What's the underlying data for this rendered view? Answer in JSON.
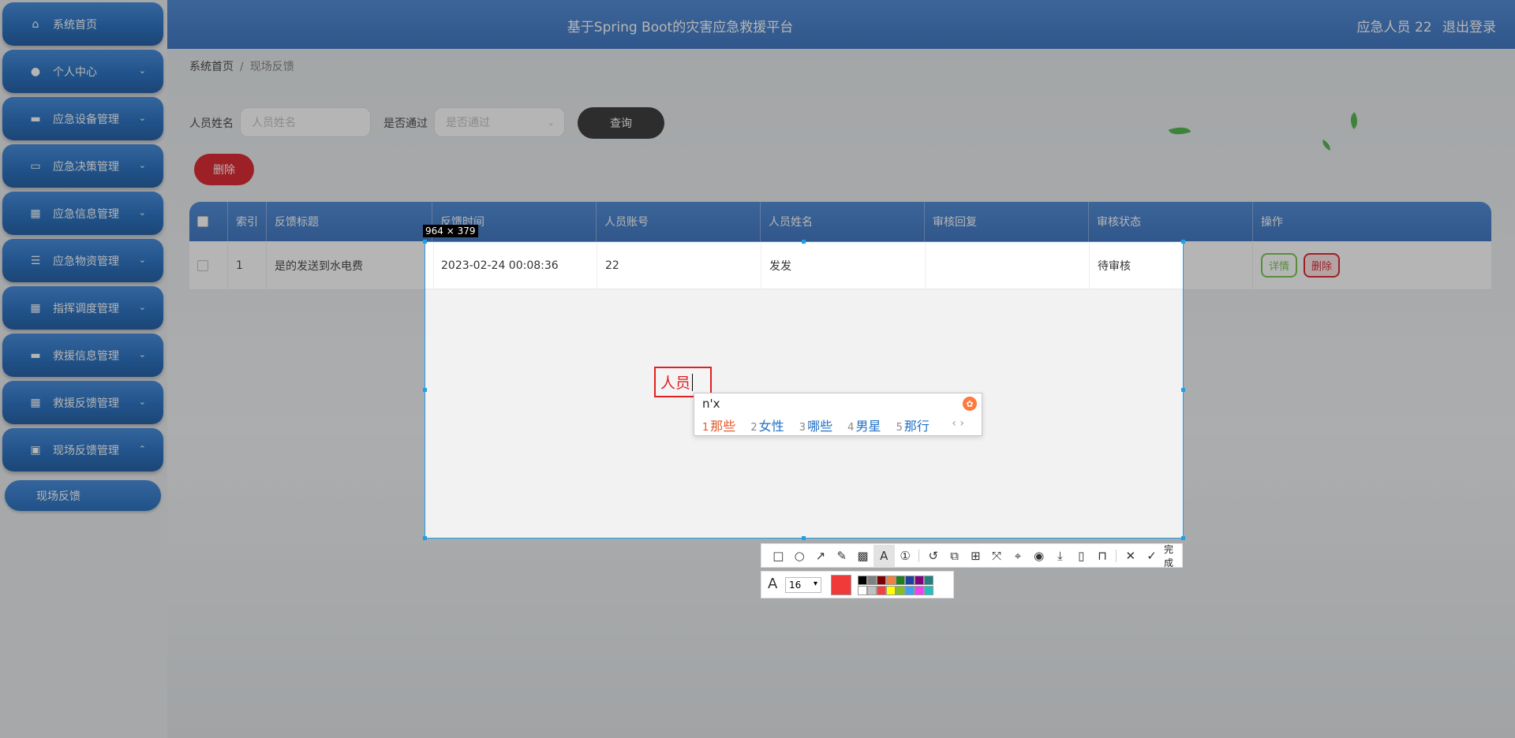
{
  "sidebar": {
    "items": [
      {
        "label": "系统首页",
        "icon": "home-icon",
        "chevron": ""
      },
      {
        "label": "个人中心",
        "icon": "user-icon",
        "chevron": "⌄"
      },
      {
        "label": "应急设备管理",
        "icon": "device-icon",
        "chevron": "⌄"
      },
      {
        "label": "应急决策管理",
        "icon": "monitor-icon",
        "chevron": "⌄"
      },
      {
        "label": "应急信息管理",
        "icon": "grid-icon",
        "chevron": "⌄"
      },
      {
        "label": "应急物资管理",
        "icon": "sliders-icon",
        "chevron": "⌄"
      },
      {
        "label": "指挥调度管理",
        "icon": "grid-icon",
        "chevron": "⌄"
      },
      {
        "label": "救援信息管理",
        "icon": "device-icon",
        "chevron": "⌄"
      },
      {
        "label": "救援反馈管理",
        "icon": "grid-icon",
        "chevron": "⌄"
      },
      {
        "label": "现场反馈管理",
        "icon": "briefcase-icon",
        "chevron": "⌃"
      }
    ],
    "submenu_label": "现场反馈"
  },
  "header": {
    "title": "基于Spring Boot的灾害应急救援平台",
    "user_label": "应急人员 22",
    "logout_label": "退出登录"
  },
  "breadcrumb": {
    "home": "系统首页",
    "separator": "/",
    "current": "现场反馈"
  },
  "search": {
    "name_label": "人员姓名",
    "name_placeholder": "人员姓名",
    "pass_label": "是否通过",
    "pass_placeholder": "是否通过",
    "query_label": "查询"
  },
  "delete_label": "删除",
  "table": {
    "columns": [
      "索引",
      "反馈标题",
      "反馈时间",
      "人员账号",
      "人员姓名",
      "审核回复",
      "审核状态",
      "操作"
    ],
    "rows": [
      {
        "index": "1",
        "title": "是的发送到水电费",
        "time": "2023-02-24 00:08:36",
        "account": "22",
        "name": "发发",
        "reply": "",
        "status": "待审核"
      }
    ],
    "detail_label": "详情",
    "delete_label": "删除"
  },
  "screenshot_tool": {
    "size_label": "964 × 379",
    "text_input": "人员",
    "done_label": "完成",
    "font_size": "16",
    "current_color": "#f03a3a",
    "palette": [
      "#000000",
      "#808080",
      "#800000",
      "#f08040",
      "#208020",
      "#2040a0",
      "#800080",
      "#208080",
      "#ffffff",
      "#c0c0c0",
      "#f04040",
      "#ffff00",
      "#80c020",
      "#40a0f0",
      "#f040f0",
      "#20c0c0"
    ]
  },
  "ime": {
    "composition": "n'x",
    "candidates": [
      {
        "n": "1",
        "text": "那些"
      },
      {
        "n": "2",
        "text": "女性"
      },
      {
        "n": "3",
        "text": "哪些"
      },
      {
        "n": "4",
        "text": "男星"
      },
      {
        "n": "5",
        "text": "那行"
      }
    ],
    "nav": "‹ ›"
  }
}
